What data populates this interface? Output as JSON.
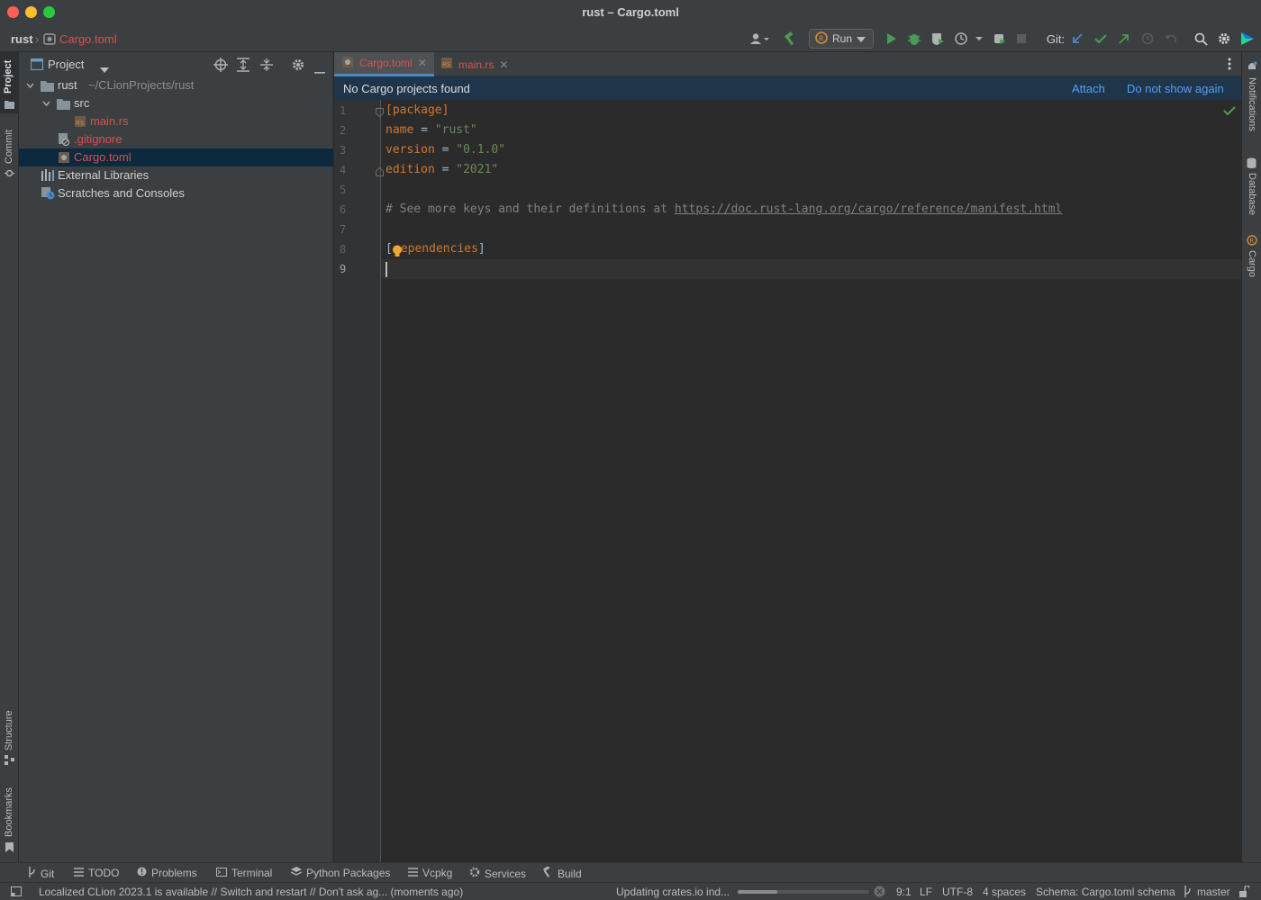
{
  "window": {
    "title": "rust – Cargo.toml"
  },
  "breadcrumb": {
    "project": "rust",
    "file": "Cargo.toml"
  },
  "toolbar": {
    "run_label": "Run",
    "git_label": "Git:"
  },
  "left_strip": {
    "project": "Project",
    "commit": "Commit",
    "structure": "Structure",
    "bookmarks": "Bookmarks"
  },
  "right_strip": {
    "notifications": "Notifications",
    "database": "Database",
    "cargo": "Cargo"
  },
  "project_panel": {
    "title": "Project",
    "tree": [
      {
        "label": "rust",
        "path": "~/CLionProjects/rust"
      },
      {
        "label": "src"
      },
      {
        "label": "main.rs"
      },
      {
        "label": ".gitignore"
      },
      {
        "label": "Cargo.toml"
      },
      {
        "label": "External Libraries"
      },
      {
        "label": "Scratches and Consoles"
      }
    ]
  },
  "editor_tabs": [
    {
      "label": "Cargo.toml"
    },
    {
      "label": "main.rs"
    }
  ],
  "banner": {
    "message": "No Cargo projects found",
    "attach": "Attach",
    "dismiss": "Do not show again"
  },
  "editor": {
    "line_numbers": [
      "1",
      "2",
      "3",
      "4",
      "5",
      "6",
      "7",
      "8",
      "9"
    ],
    "code": {
      "l1": "[package]",
      "l2_key": "name",
      "l2_eq": " = ",
      "l2_val": "\"rust\"",
      "l3_key": "version",
      "l3_eq": " = ",
      "l3_val": "\"0.1.0\"",
      "l4_key": "edition",
      "l4_eq": " = ",
      "l4_val": "\"2021\"",
      "l6_comment": "# See more keys and their definitions at ",
      "l6_link": "https://doc.rust-lang.org/cargo/reference/manifest.html",
      "l8_open": "[",
      "l8_text": "ependencies",
      "l8_close": "]"
    }
  },
  "bottom_tabs": [
    "Git",
    "TODO",
    "Problems",
    "Terminal",
    "Python Packages",
    "Vcpkg",
    "Services",
    "Build"
  ],
  "status": {
    "message": "Localized CLion 2023.1 is available // Switch and restart // Don't ask ag... (moments ago)",
    "progress_text": "Updating crates.io ind...",
    "progress": 0.3,
    "position": "9:1",
    "line_sep": "LF",
    "encoding": "UTF-8",
    "indent": "4 spaces",
    "schema": "Schema: Cargo.toml schema",
    "branch": "master"
  },
  "colors": {
    "keyword": "#cc7832",
    "string": "#6a8759",
    "comment": "#808080",
    "accent": "#4a88c7",
    "modified_file": "#d25252",
    "run_green": "#499c54"
  }
}
